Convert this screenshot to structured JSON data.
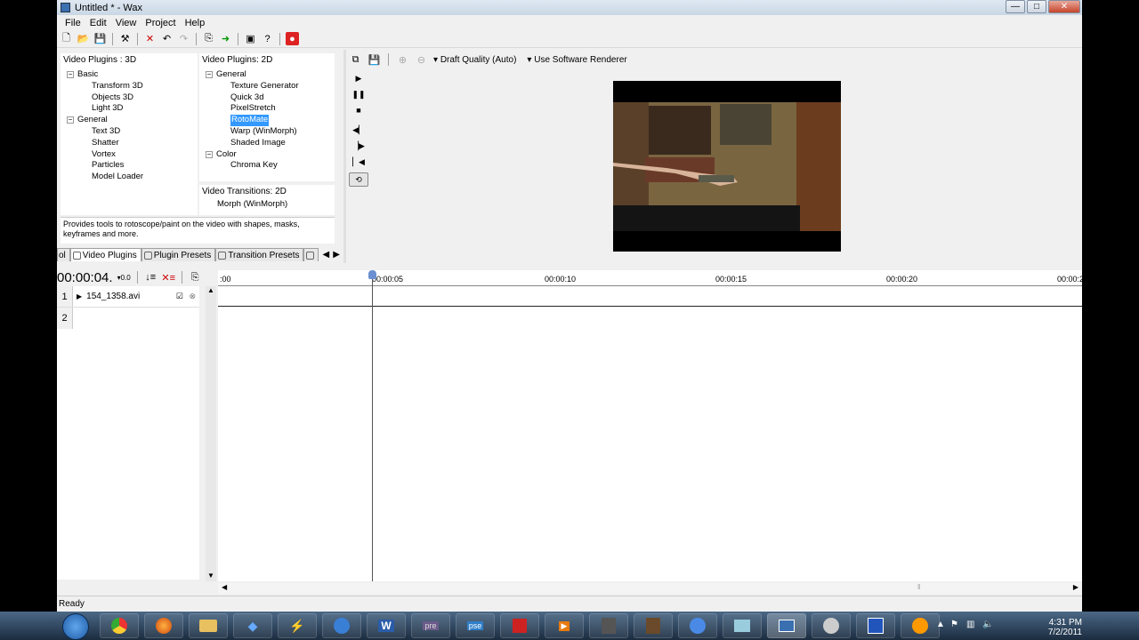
{
  "window": {
    "title": "Untitled * - Wax"
  },
  "menu": [
    "File",
    "Edit",
    "View",
    "Project",
    "Help"
  ],
  "panels": {
    "plugins3d": {
      "title": "Video Plugins : 3D",
      "items": [
        {
          "label": "Basic",
          "group": true
        },
        {
          "label": "Transform 3D"
        },
        {
          "label": "Objects 3D"
        },
        {
          "label": "Light 3D"
        },
        {
          "label": "General",
          "group": true
        },
        {
          "label": "Text 3D"
        },
        {
          "label": "Shatter"
        },
        {
          "label": "Vortex"
        },
        {
          "label": "Particles"
        },
        {
          "label": "Model Loader"
        }
      ]
    },
    "plugins2d": {
      "title": "Video Plugins: 2D",
      "items": [
        {
          "label": "General",
          "group": true
        },
        {
          "label": "Texture Generator"
        },
        {
          "label": "Quick 3d"
        },
        {
          "label": "PixelStretch"
        },
        {
          "label": "RotoMate",
          "selected": true
        },
        {
          "label": "Warp (WinMorph)"
        },
        {
          "label": "Shaded Image"
        },
        {
          "label": "Color",
          "group": true
        },
        {
          "label": "Chroma Key"
        }
      ]
    },
    "transitions": {
      "title": "Video Transitions: 2D",
      "items": [
        "Morph (WinMorph)"
      ]
    },
    "description": "Provides tools to rotoscope/paint on the video with shapes, masks, keyframes and more.",
    "tabs": [
      {
        "label": "ol",
        "partial": true
      },
      {
        "label": "Video Plugins",
        "active": true
      },
      {
        "label": "Plugin Presets"
      },
      {
        "label": "Transition Presets"
      }
    ]
  },
  "preview": {
    "quality": "Draft Quality (Auto)",
    "renderer": "Use Software Renderer"
  },
  "timeline": {
    "timecode": "00:00:04.",
    "zoom": "0.0",
    "ruler": [
      ":00",
      "00:00:05",
      "00:00:10",
      "00:00:15",
      "00:00:20",
      "00:00:2"
    ],
    "tracks": [
      {
        "num": "1",
        "name": "154_1358.avi"
      },
      {
        "num": "2",
        "name": ""
      }
    ]
  },
  "status": "Ready",
  "clock": {
    "time": "4:31 PM",
    "date": "7/2/2011"
  }
}
